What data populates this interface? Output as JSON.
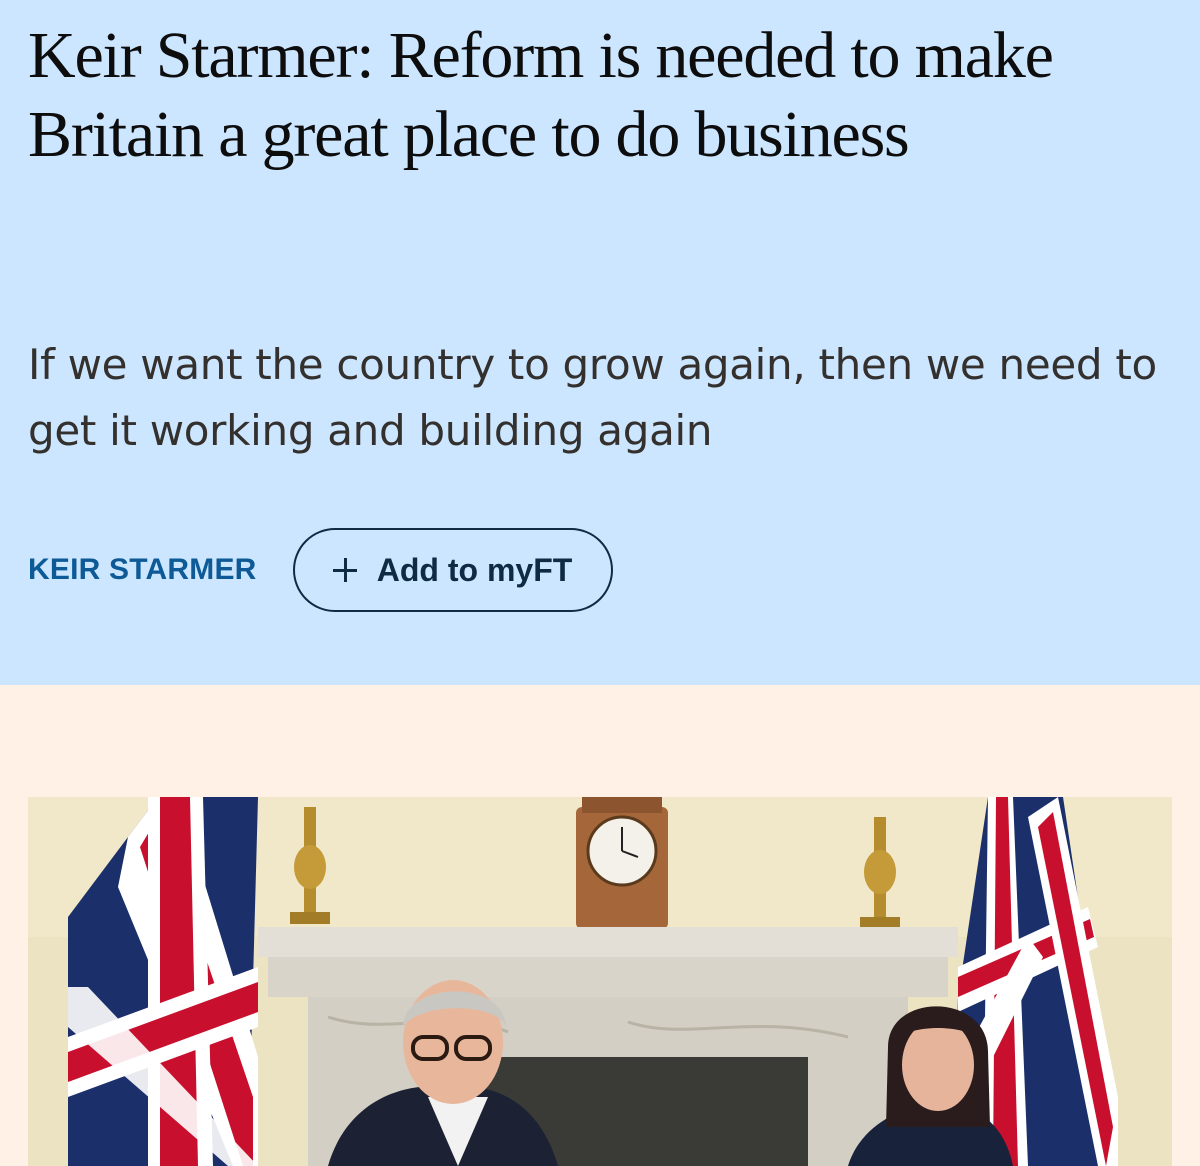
{
  "article": {
    "headline": "Keir Starmer: Reform is needed to make Britain a great place to do business",
    "standfirst": "If we want the country to grow again, then we need to get it working and building again",
    "author": "KEIR STARMER",
    "myft_label": "Add to myFT"
  },
  "hero_image": {
    "description_alt": "Keir Starmer and Rachel Reeves seated before a marble fireplace with Union flags",
    "subjects": [
      "union-flag",
      "mantel-clock",
      "marble-fireplace",
      "candelabra",
      "man-with-glasses",
      "woman-with-dark-hair"
    ]
  },
  "colors": {
    "header_background": "#cce6ff",
    "page_background": "#fff1e5",
    "author_link": "#0d5a96",
    "button_outline": "#0f2a45"
  }
}
